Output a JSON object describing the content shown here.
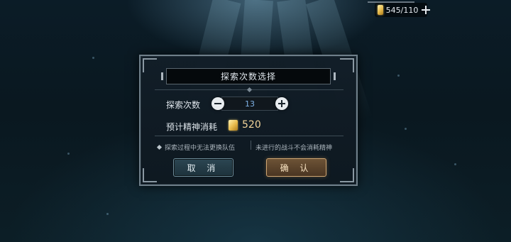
{
  "currency": {
    "value": "545/110",
    "icon": "gold-coin-icon",
    "add_icon": "plus-icon"
  },
  "dialog": {
    "title": "探索次数选择",
    "count_label": "探索次数",
    "count_value": "13",
    "cost_label": "预计精神消耗",
    "cost_value": "520",
    "note_left": "探索过程中无法更换队伍",
    "note_right": "未进行的战斗不会消耗精神",
    "cancel_label": "取 消",
    "confirm_label": "确 认"
  },
  "colors": {
    "accent_gold": "#f2d49a",
    "count_blue": "#7fb2e6",
    "confirm_border": "#d1a773"
  }
}
